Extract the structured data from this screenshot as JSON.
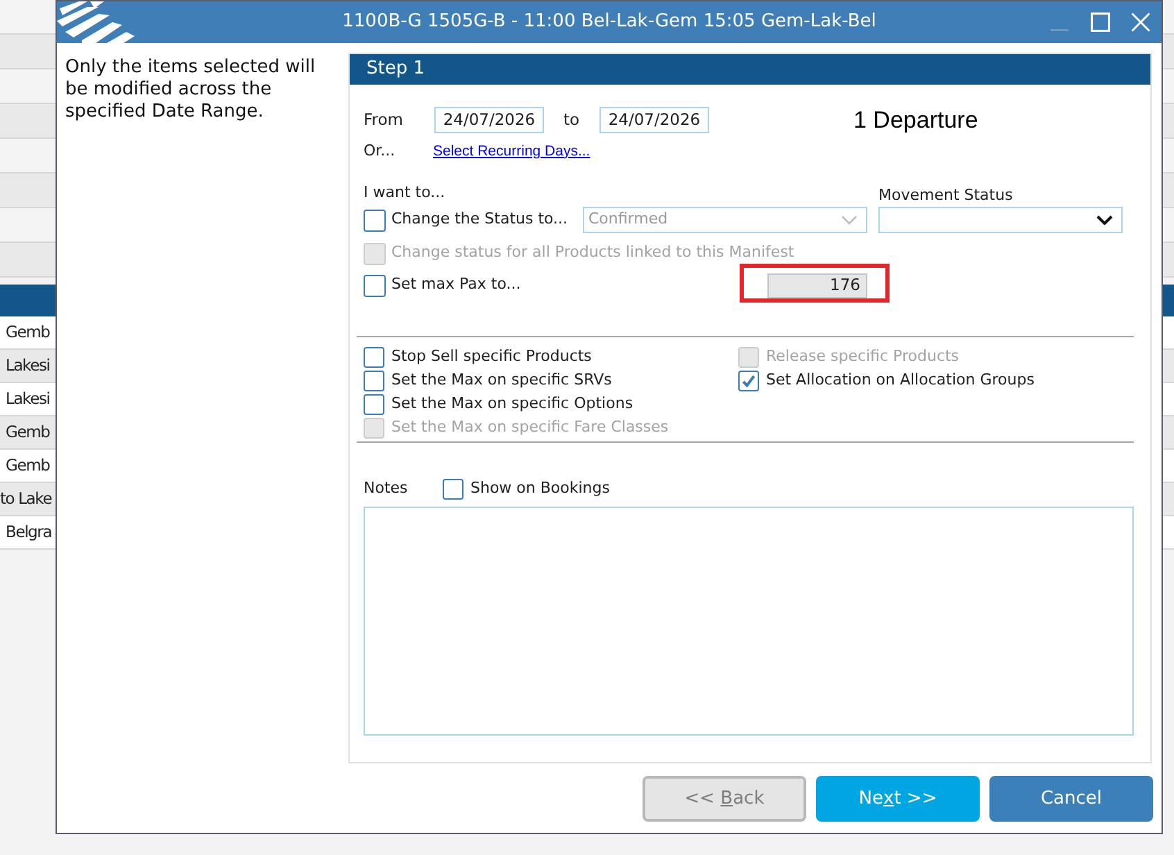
{
  "background_table": {
    "rows": [
      "Gemb",
      "Lakesi",
      "Lakesi",
      "Gemb",
      "Gemb",
      "to Lake",
      "Belgra"
    ]
  },
  "window": {
    "title": "1100B-G 1505G-B - 11:00 Bel-Lak-Gem 15:05 Gem-Lak-Bel",
    "controls": [
      {
        "kind": "minimize",
        "disabled": true
      },
      {
        "kind": "maximize",
        "disabled": false
      },
      {
        "kind": "close",
        "disabled": false
      }
    ]
  },
  "intro_text": "Only the items selected will be modified across the specified Date Range.",
  "step": {
    "title": "Step 1"
  },
  "date_range": {
    "from_label": "From",
    "from_value": "24/07/2026",
    "to_label": "to",
    "to_value": "24/07/2026",
    "or_label": "Or...",
    "recurring_link": "Select Recurring Days...",
    "departures": "1 Departure"
  },
  "actions": {
    "heading": "I want to...",
    "change_status": {
      "label": "Change the Status to...",
      "checked": false,
      "disabled": false
    },
    "status_select": {
      "value": "Confirmed",
      "disabled": true
    },
    "all_products": {
      "label": "Change status for all Products linked to this Manifest",
      "checked": false,
      "disabled": true
    },
    "max_pax": {
      "label": "Set max Pax to...",
      "checked": false,
      "disabled": false,
      "value": "176",
      "input_disabled": true,
      "highlighted": true
    }
  },
  "movement_status": {
    "label": "Movement Status"
  },
  "option_columns": [
    {
      "items": [
        {
          "label": "Stop Sell specific Products",
          "checked": false,
          "disabled": false
        },
        {
          "label": "Set the Max on specific SRVs",
          "checked": false,
          "disabled": false
        },
        {
          "label": "Set the Max on specific Options",
          "checked": false,
          "disabled": false
        },
        {
          "label": "Set the Max on specific Fare Classes",
          "checked": false,
          "disabled": true
        }
      ]
    },
    {
      "items": [
        {
          "label": "Release specific Products",
          "checked": false,
          "disabled": true
        },
        {
          "label": "Set Allocation on Allocation Groups",
          "checked": true,
          "disabled": false
        }
      ]
    }
  ],
  "notes": {
    "label": "Notes",
    "show_on_bookings": {
      "label": "Show on Bookings",
      "checked": false,
      "disabled": false
    }
  },
  "buttons": [
    {
      "kind": "back",
      "text": "<< ",
      "key": "B",
      "rest": "ack",
      "disabled": true
    },
    {
      "kind": "next",
      "text": "Ne",
      "key": "x",
      "rest": "t >>",
      "disabled": false
    },
    {
      "kind": "cancel",
      "text": "Cancel",
      "disabled": false
    }
  ]
}
